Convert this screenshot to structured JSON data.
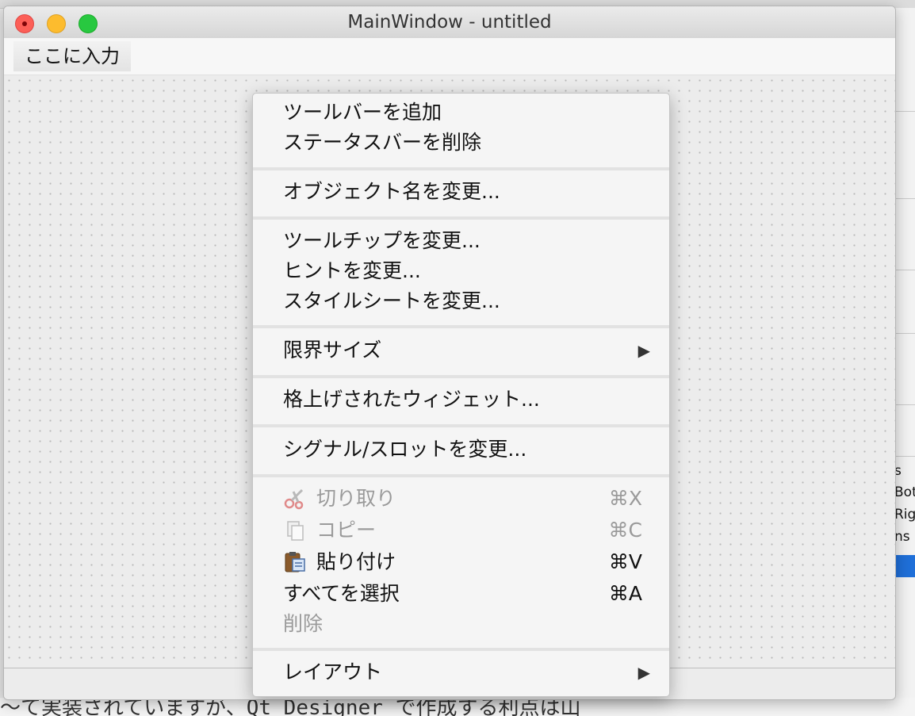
{
  "window": {
    "title": "MainWindow - untitled"
  },
  "menubar": {
    "placeholder": "ここに入力"
  },
  "context_menu": {
    "items": [
      {
        "label": "ツールバーを追加",
        "enabled": true
      },
      {
        "label": "ステータスバーを削除",
        "enabled": true
      },
      {
        "label": "オブジェクト名を変更...",
        "enabled": true
      },
      {
        "label": "ツールチップを変更...",
        "enabled": true
      },
      {
        "label": "ヒントを変更...",
        "enabled": true
      },
      {
        "label": "スタイルシートを変更...",
        "enabled": true
      },
      {
        "label": "限界サイズ",
        "enabled": true,
        "submenu": true
      },
      {
        "label": "格上げされたウィジェット...",
        "enabled": true
      },
      {
        "label": "シグナル/スロットを変更...",
        "enabled": true
      },
      {
        "label": "切り取り",
        "shortcut": "⌘X",
        "enabled": false,
        "icon": "scissors-icon"
      },
      {
        "label": "コピー",
        "shortcut": "⌘C",
        "enabled": false,
        "icon": "copy-icon"
      },
      {
        "label": "貼り付け",
        "shortcut": "⌘V",
        "enabled": true,
        "icon": "paste-icon"
      },
      {
        "label": "すべてを選択",
        "shortcut": "⌘A",
        "enabled": true
      },
      {
        "label": "削除",
        "enabled": false
      },
      {
        "label": "レイアウト",
        "enabled": true,
        "submenu": true
      }
    ],
    "submenu_arrow": "▶"
  },
  "background": {
    "doc_text": "〜て実装されていますが、Qt Designer で作成する利点は山",
    "right_panel_text": [
      "s",
      "Bott",
      "Righ",
      "ns"
    ]
  }
}
